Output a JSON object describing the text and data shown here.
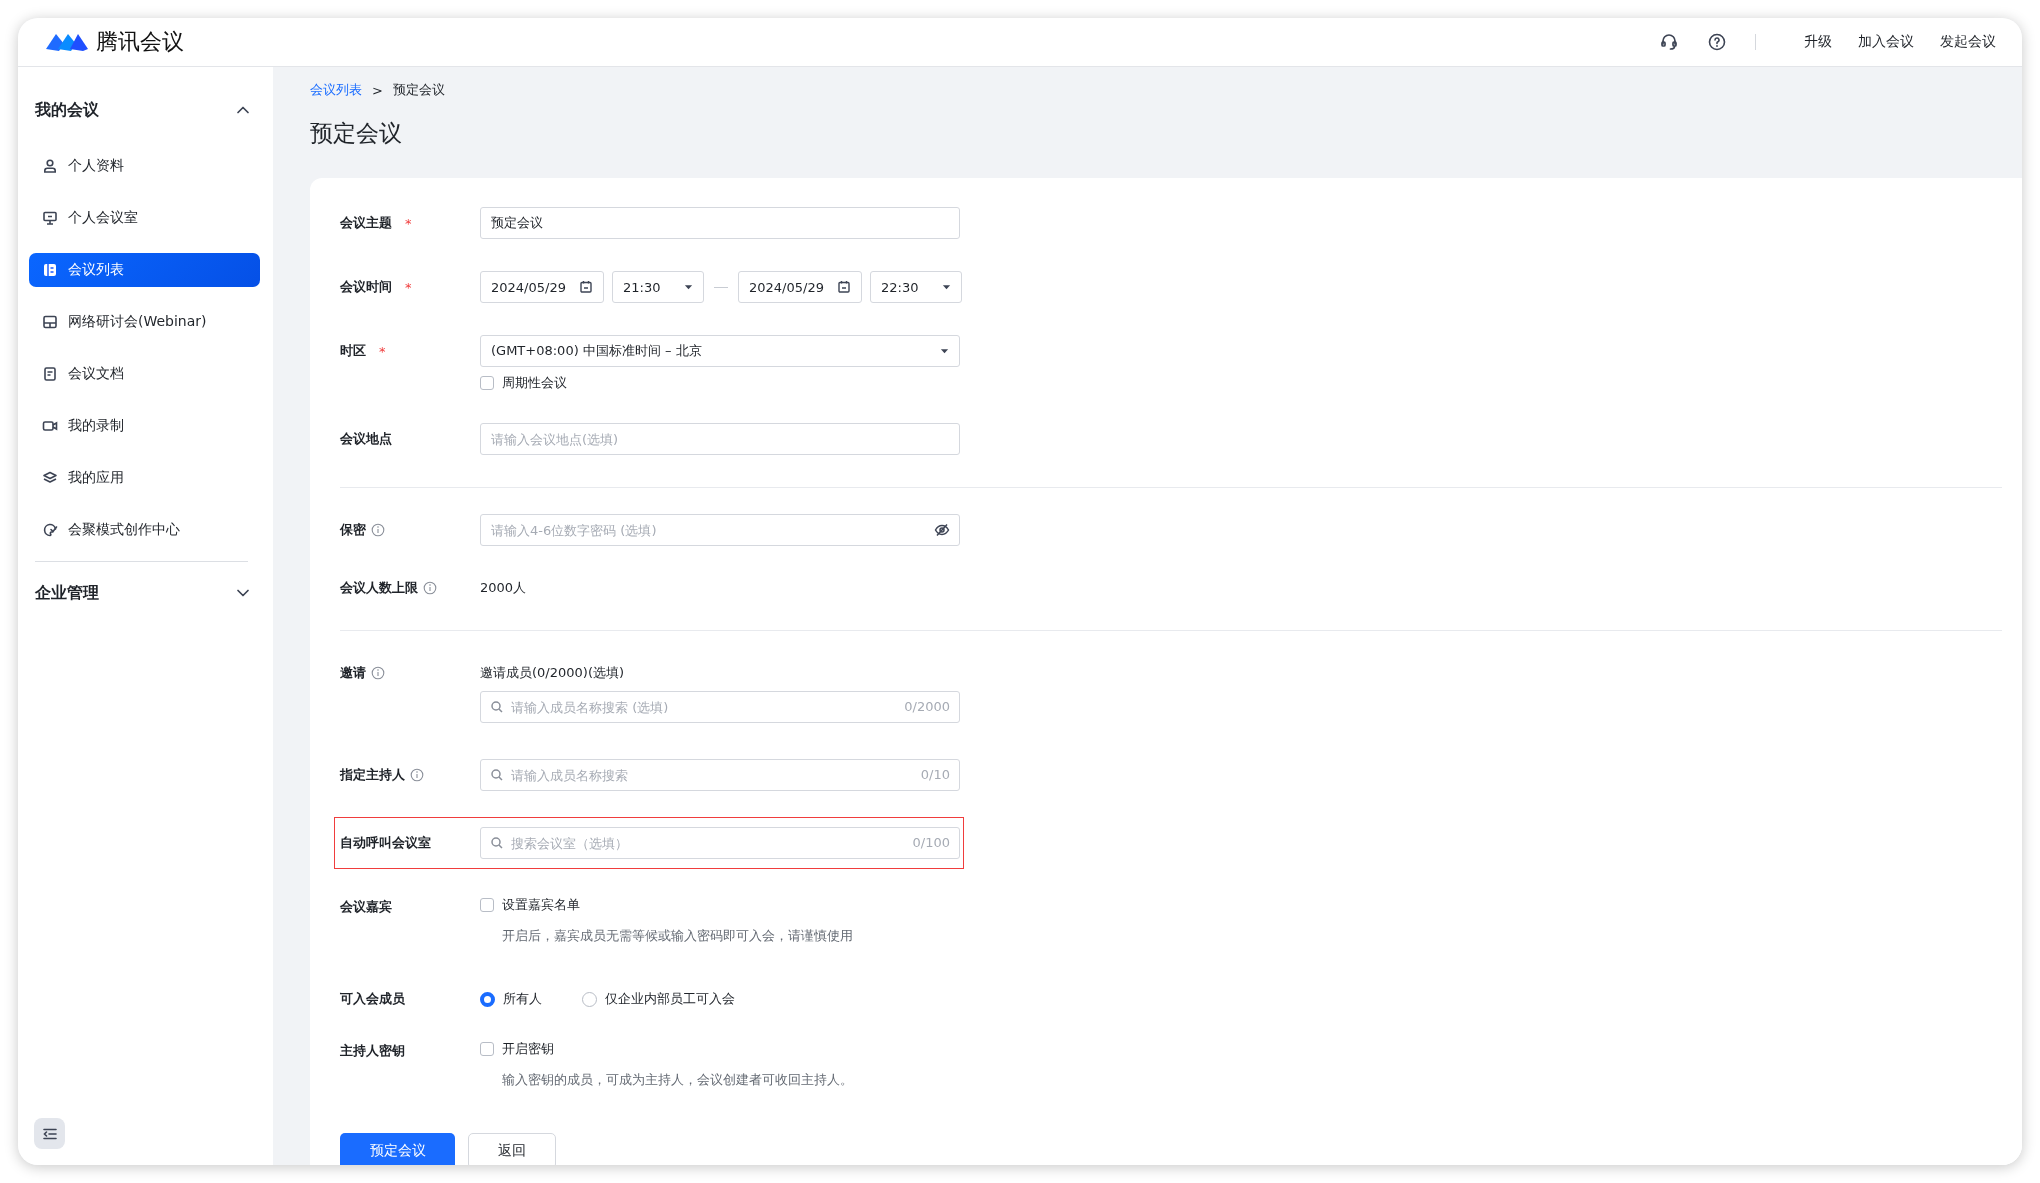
{
  "app": {
    "name": "腾讯会议"
  },
  "topbar": {
    "links": [
      "升级",
      "加入会议",
      "发起会议"
    ]
  },
  "sidebar": {
    "groups": [
      {
        "title": "我的会议",
        "expanded": true,
        "items": [
          {
            "label": "个人资料",
            "selected": false
          },
          {
            "label": "个人会议室",
            "selected": false
          },
          {
            "label": "会议列表",
            "selected": true
          },
          {
            "label": "网络研讨会(Webinar)",
            "selected": false
          },
          {
            "label": "会议文档",
            "selected": false
          },
          {
            "label": "我的录制",
            "selected": false
          },
          {
            "label": "我的应用",
            "selected": false
          },
          {
            "label": "会聚模式创作中心",
            "selected": false
          }
        ]
      },
      {
        "title": "企业管理",
        "expanded": false
      }
    ]
  },
  "breadcrumb": {
    "link": "会议列表",
    "separator": ">",
    "current": "预定会议"
  },
  "page_title": "预定会议",
  "form": [
    {
      "kind": "text",
      "label": "会议主题",
      "required": "*",
      "info": false,
      "highlighted": false,
      "value": "预定会议"
    },
    {
      "kind": "time",
      "label": "会议时间",
      "required": "*",
      "info": false,
      "highlighted": false,
      "start_date": "2024/05/29",
      "start_time": "21:30",
      "end_date": "2024/05/29",
      "end_time": "22:30"
    },
    {
      "kind": "select",
      "label": "时区",
      "required": "*",
      "info": false,
      "highlighted": false,
      "value": "(GMT+08:00) 中国标准时间 – 北京",
      "option": {
        "label": "周期性会议",
        "checked": false
      }
    },
    {
      "kind": "text",
      "label": "会议地点",
      "info": false,
      "highlighted": false,
      "placeholder": "请输入会议地点(选填)"
    },
    {
      "kind": "divider"
    },
    {
      "kind": "password",
      "label": "保密",
      "info": true,
      "highlighted": false,
      "placeholder": "请输入4-6位数字密码 (选填)"
    },
    {
      "kind": "static",
      "label": "会议人数上限",
      "info": true,
      "highlighted": false,
      "value": "2000人"
    },
    {
      "kind": "divider"
    },
    {
      "kind": "search",
      "label": "邀请",
      "info": true,
      "highlighted": false,
      "caption": "邀请成员(0/2000)(选填)",
      "placeholder": "请输入成员名称搜索 (选填)",
      "count": "0/2000"
    },
    {
      "kind": "search",
      "label": "指定主持人",
      "info": true,
      "highlighted": false,
      "placeholder": "请输入成员名称搜索",
      "count": "0/10"
    },
    {
      "kind": "search",
      "label": "自动呼叫会议室",
      "info": false,
      "highlighted": true,
      "placeholder": "搜索会议室（选填）",
      "count": "0/100"
    },
    {
      "kind": "checkbox",
      "label": "会议嘉宾",
      "info": false,
      "highlighted": false,
      "option": {
        "label": "设置嘉宾名单",
        "checked": false
      },
      "hint": "开启后，嘉宾成员无需等候或输入密码即可入会，请谨慎使用"
    },
    {
      "kind": "radio",
      "label": "可入会成员",
      "info": false,
      "highlighted": false,
      "options": [
        {
          "label": "所有人",
          "selected": true
        },
        {
          "label": "仅企业内部员工可入会",
          "selected": false
        }
      ]
    },
    {
      "kind": "checkbox",
      "label": "主持人密钥",
      "info": false,
      "highlighted": false,
      "option": {
        "label": "开启密钥",
        "checked": false
      },
      "hint": "输入密钥的成员，可成为主持人，会议创建者可收回主持人。"
    }
  ],
  "buttons": [
    {
      "label": "预定会议",
      "primary": true
    },
    {
      "label": "返回",
      "primary": false
    }
  ]
}
